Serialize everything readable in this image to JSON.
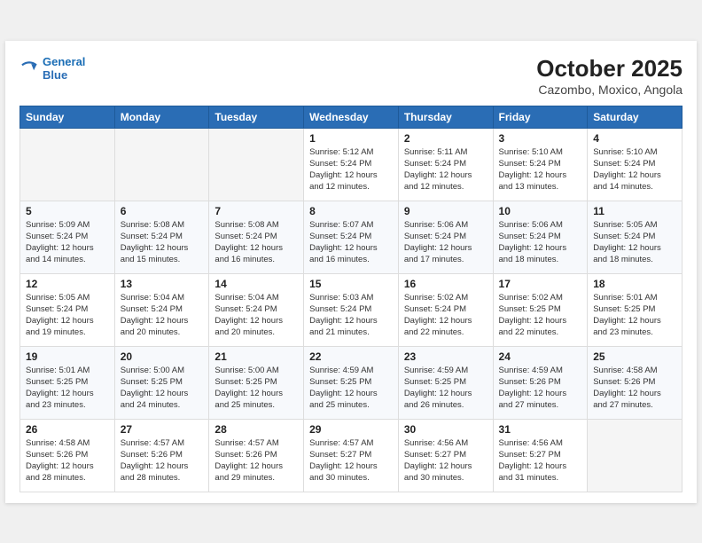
{
  "logo": {
    "line1": "General",
    "line2": "Blue"
  },
  "title": "October 2025",
  "subtitle": "Cazombo, Moxico, Angola",
  "days_of_week": [
    "Sunday",
    "Monday",
    "Tuesday",
    "Wednesday",
    "Thursday",
    "Friday",
    "Saturday"
  ],
  "weeks": [
    [
      {
        "day": "",
        "info": ""
      },
      {
        "day": "",
        "info": ""
      },
      {
        "day": "",
        "info": ""
      },
      {
        "day": "1",
        "info": "Sunrise: 5:12 AM\nSunset: 5:24 PM\nDaylight: 12 hours\nand 12 minutes."
      },
      {
        "day": "2",
        "info": "Sunrise: 5:11 AM\nSunset: 5:24 PM\nDaylight: 12 hours\nand 12 minutes."
      },
      {
        "day": "3",
        "info": "Sunrise: 5:10 AM\nSunset: 5:24 PM\nDaylight: 12 hours\nand 13 minutes."
      },
      {
        "day": "4",
        "info": "Sunrise: 5:10 AM\nSunset: 5:24 PM\nDaylight: 12 hours\nand 14 minutes."
      }
    ],
    [
      {
        "day": "5",
        "info": "Sunrise: 5:09 AM\nSunset: 5:24 PM\nDaylight: 12 hours\nand 14 minutes."
      },
      {
        "day": "6",
        "info": "Sunrise: 5:08 AM\nSunset: 5:24 PM\nDaylight: 12 hours\nand 15 minutes."
      },
      {
        "day": "7",
        "info": "Sunrise: 5:08 AM\nSunset: 5:24 PM\nDaylight: 12 hours\nand 16 minutes."
      },
      {
        "day": "8",
        "info": "Sunrise: 5:07 AM\nSunset: 5:24 PM\nDaylight: 12 hours\nand 16 minutes."
      },
      {
        "day": "9",
        "info": "Sunrise: 5:06 AM\nSunset: 5:24 PM\nDaylight: 12 hours\nand 17 minutes."
      },
      {
        "day": "10",
        "info": "Sunrise: 5:06 AM\nSunset: 5:24 PM\nDaylight: 12 hours\nand 18 minutes."
      },
      {
        "day": "11",
        "info": "Sunrise: 5:05 AM\nSunset: 5:24 PM\nDaylight: 12 hours\nand 18 minutes."
      }
    ],
    [
      {
        "day": "12",
        "info": "Sunrise: 5:05 AM\nSunset: 5:24 PM\nDaylight: 12 hours\nand 19 minutes."
      },
      {
        "day": "13",
        "info": "Sunrise: 5:04 AM\nSunset: 5:24 PM\nDaylight: 12 hours\nand 20 minutes."
      },
      {
        "day": "14",
        "info": "Sunrise: 5:04 AM\nSunset: 5:24 PM\nDaylight: 12 hours\nand 20 minutes."
      },
      {
        "day": "15",
        "info": "Sunrise: 5:03 AM\nSunset: 5:24 PM\nDaylight: 12 hours\nand 21 minutes."
      },
      {
        "day": "16",
        "info": "Sunrise: 5:02 AM\nSunset: 5:24 PM\nDaylight: 12 hours\nand 22 minutes."
      },
      {
        "day": "17",
        "info": "Sunrise: 5:02 AM\nSunset: 5:25 PM\nDaylight: 12 hours\nand 22 minutes."
      },
      {
        "day": "18",
        "info": "Sunrise: 5:01 AM\nSunset: 5:25 PM\nDaylight: 12 hours\nand 23 minutes."
      }
    ],
    [
      {
        "day": "19",
        "info": "Sunrise: 5:01 AM\nSunset: 5:25 PM\nDaylight: 12 hours\nand 23 minutes."
      },
      {
        "day": "20",
        "info": "Sunrise: 5:00 AM\nSunset: 5:25 PM\nDaylight: 12 hours\nand 24 minutes."
      },
      {
        "day": "21",
        "info": "Sunrise: 5:00 AM\nSunset: 5:25 PM\nDaylight: 12 hours\nand 25 minutes."
      },
      {
        "day": "22",
        "info": "Sunrise: 4:59 AM\nSunset: 5:25 PM\nDaylight: 12 hours\nand 25 minutes."
      },
      {
        "day": "23",
        "info": "Sunrise: 4:59 AM\nSunset: 5:25 PM\nDaylight: 12 hours\nand 26 minutes."
      },
      {
        "day": "24",
        "info": "Sunrise: 4:59 AM\nSunset: 5:26 PM\nDaylight: 12 hours\nand 27 minutes."
      },
      {
        "day": "25",
        "info": "Sunrise: 4:58 AM\nSunset: 5:26 PM\nDaylight: 12 hours\nand 27 minutes."
      }
    ],
    [
      {
        "day": "26",
        "info": "Sunrise: 4:58 AM\nSunset: 5:26 PM\nDaylight: 12 hours\nand 28 minutes."
      },
      {
        "day": "27",
        "info": "Sunrise: 4:57 AM\nSunset: 5:26 PM\nDaylight: 12 hours\nand 28 minutes."
      },
      {
        "day": "28",
        "info": "Sunrise: 4:57 AM\nSunset: 5:26 PM\nDaylight: 12 hours\nand 29 minutes."
      },
      {
        "day": "29",
        "info": "Sunrise: 4:57 AM\nSunset: 5:27 PM\nDaylight: 12 hours\nand 30 minutes."
      },
      {
        "day": "30",
        "info": "Sunrise: 4:56 AM\nSunset: 5:27 PM\nDaylight: 12 hours\nand 30 minutes."
      },
      {
        "day": "31",
        "info": "Sunrise: 4:56 AM\nSunset: 5:27 PM\nDaylight: 12 hours\nand 31 minutes."
      },
      {
        "day": "",
        "info": ""
      }
    ]
  ]
}
